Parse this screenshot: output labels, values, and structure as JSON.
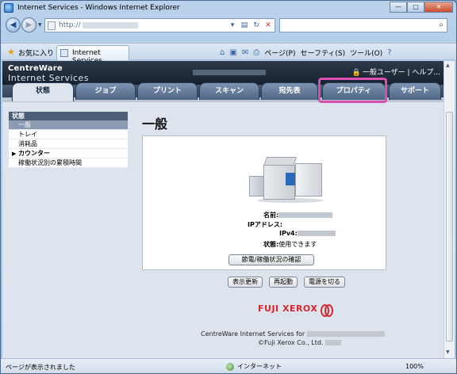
{
  "window": {
    "title": "Internet Services - Windows Internet Explorer",
    "min": "—",
    "max": "□",
    "close": "✕"
  },
  "address": {
    "url": "http://"
  },
  "search": {
    "placeholder": ""
  },
  "favorites": {
    "label": "お気に入り",
    "tab_title": "Internet Services"
  },
  "commands": {
    "page": "ページ(P)",
    "safety": "セーフティ(S)",
    "tools": "ツール(O)",
    "help": "?"
  },
  "cw": {
    "logo_line1": "CentreWare",
    "logo_line2": "Internet Services",
    "user_links": "一般ユーザー | ヘルプ...",
    "tabs": [
      "状態",
      "ジョブ",
      "プリント",
      "スキャン",
      "宛先表",
      "プロパティ",
      "サポート"
    ],
    "sidebar": {
      "header": "状態",
      "items": [
        "一般",
        "トレイ",
        "消耗品",
        "カウンター",
        "稼働状況別の累積時間"
      ]
    },
    "main_title": "一般",
    "info": {
      "name_label": "名前:",
      "ip_label": "IPアドレス:",
      "ipv4_label": "IPv4:",
      "status_label": "状態:",
      "status_value": "使用できます",
      "power_button": "節電/稼働状況の確認"
    },
    "actions": {
      "refresh": "表示更新",
      "restart": "再起動",
      "power_off": "電源を切る"
    },
    "brand": "FUJI XEROX",
    "footer_line1": "CentreWare Internet Services for",
    "footer_line2": "©Fuji Xerox Co., Ltd."
  },
  "status": {
    "left": "ページが表示されました",
    "zone": "インターネット",
    "zoom": "100%"
  },
  "colors": {
    "highlight": "#d94fb1",
    "header_dark": "#17202c",
    "brand_red": "#d8262c"
  }
}
